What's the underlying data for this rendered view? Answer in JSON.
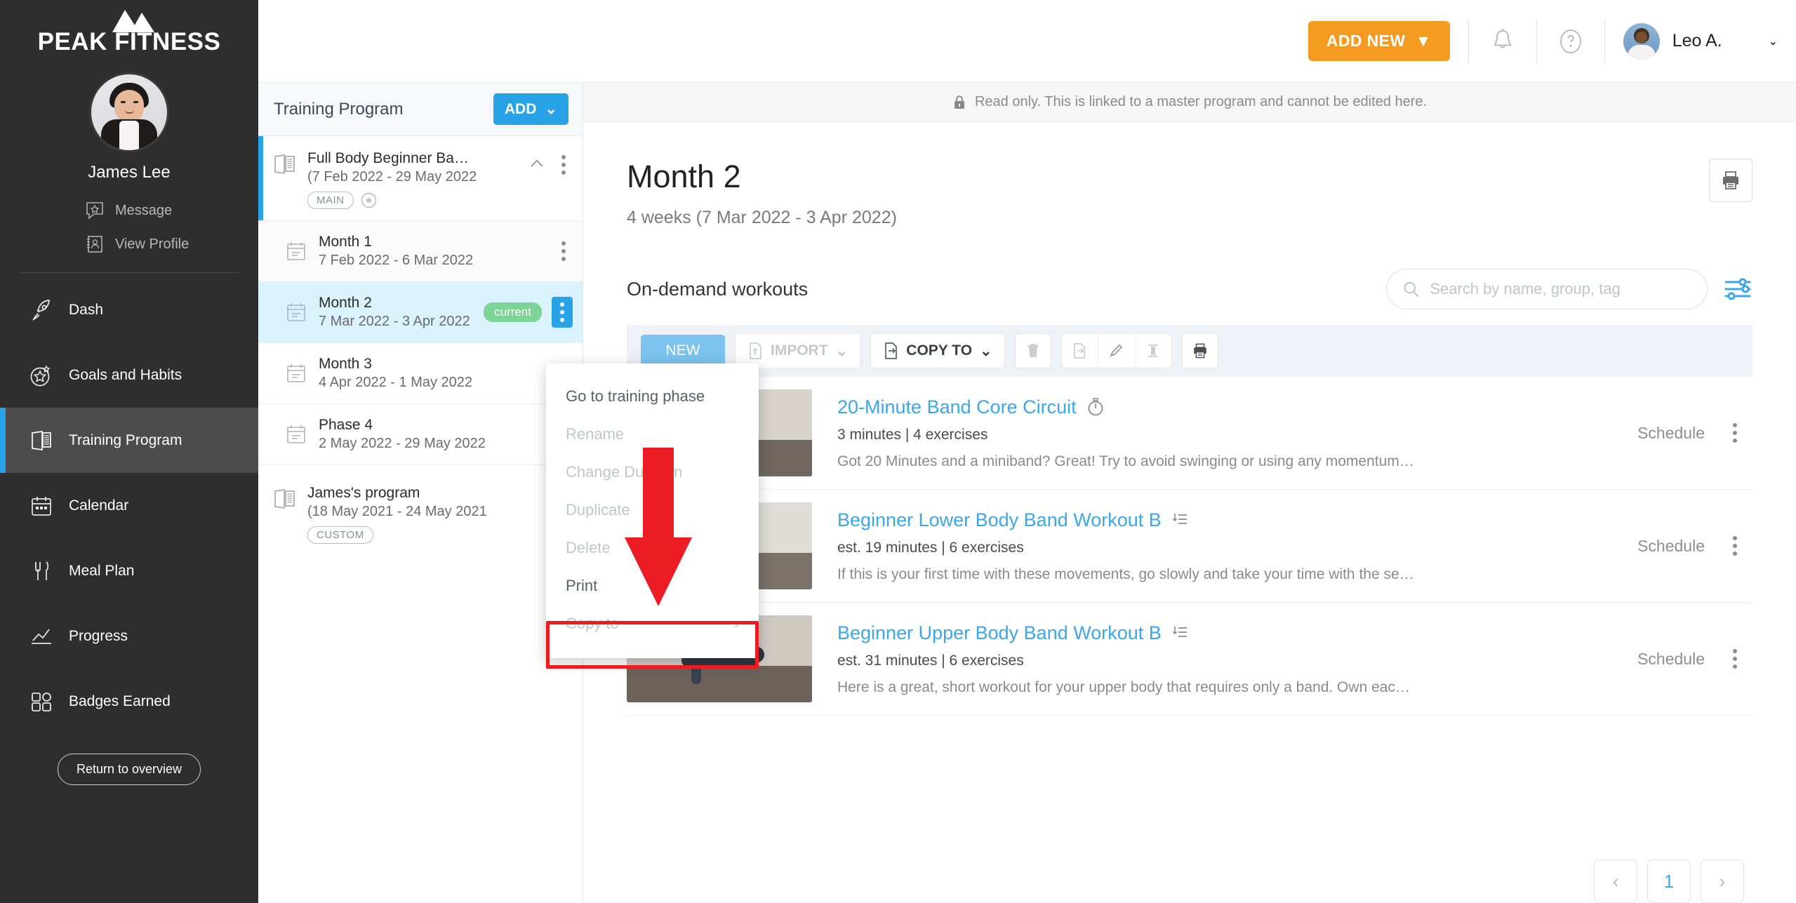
{
  "brand": {
    "name": "PEAK FITNESS",
    "logo_icon": "mountain-peaks-icon"
  },
  "profile": {
    "name": "James Lee",
    "links": [
      {
        "label": "Message",
        "icon": "message-star-icon"
      },
      {
        "label": "View Profile",
        "icon": "contact-book-icon"
      }
    ]
  },
  "sidebar": {
    "items": [
      {
        "label": "Dash",
        "icon": "rocket-icon",
        "active": false
      },
      {
        "label": "Goals and Habits",
        "icon": "star-burst-icon",
        "active": false
      },
      {
        "label": "Training Program",
        "icon": "program-book-icon",
        "active": true
      },
      {
        "label": "Calendar",
        "icon": "calendar-icon",
        "active": false
      },
      {
        "label": "Meal Plan",
        "icon": "fork-knife-icon",
        "active": false
      },
      {
        "label": "Progress",
        "icon": "chart-line-icon",
        "active": false
      },
      {
        "label": "Badges Earned",
        "icon": "badges-grid-icon",
        "active": false
      }
    ],
    "return_button": "Return to overview"
  },
  "topbar": {
    "add_new_label": "ADD NEW",
    "add_new_caret": "▼",
    "add_new_color": "#f59b22",
    "bell_icon": "bell-icon",
    "help_icon": "question-circle-icon",
    "user_name": "Leo A.",
    "user_caret": "⌄"
  },
  "program_panel": {
    "title": "Training Program",
    "add_label": "ADD",
    "add_caret": "⌄",
    "programs": [
      {
        "name": "Full Body Beginner Ba…",
        "dates": "(7 Feb 2022 - 29 May 2022",
        "tag": "MAIN",
        "link_icon": "link-icon",
        "collapse_icon": "chevron-up-icon",
        "selected": true,
        "phases": [
          {
            "name": "Month 1",
            "dates": "7 Feb 2022 - 6 Mar 2022",
            "badge": "",
            "active": false
          },
          {
            "name": "Month 2",
            "dates": "7 Mar 2022 - 3 Apr 2022",
            "badge": "current",
            "active": true
          },
          {
            "name": "Month 3",
            "dates": "4 Apr 2022 - 1 May 2022",
            "badge": "",
            "active": false
          },
          {
            "name": "Phase 4",
            "dates": "2 May 2022 - 29 May 2022",
            "badge": "",
            "active": false
          }
        ]
      },
      {
        "name": "James's program",
        "dates": "(18 May 2021 - 24 May 2021",
        "tag": "CUSTOM",
        "link_icon": "",
        "collapse_icon": "chevron-down-icon",
        "selected": false,
        "phases": []
      }
    ],
    "badge_current_color": "#7ed396"
  },
  "context_menu": {
    "items": [
      {
        "label": "Go to training phase",
        "disabled": false,
        "submenu": false,
        "highlighted": false
      },
      {
        "label": "Rename",
        "disabled": true,
        "submenu": false,
        "highlighted": false
      },
      {
        "label": "Change Duration",
        "disabled": true,
        "submenu": false,
        "highlighted": false
      },
      {
        "label": "Duplicate",
        "disabled": true,
        "submenu": false,
        "highlighted": false
      },
      {
        "label": "Delete",
        "disabled": true,
        "submenu": false,
        "highlighted": false
      },
      {
        "label": "Print",
        "disabled": false,
        "submenu": false,
        "highlighted": true
      },
      {
        "label": "Copy to",
        "disabled": true,
        "submenu": true,
        "highlighted": false
      }
    ],
    "submenu_arrow": "›",
    "highlight_color": "#ec1c24",
    "annotation_arrow_color": "#ec1c24"
  },
  "content": {
    "readonly_notice": "Read only. This is linked to a master program and cannot be edited here.",
    "lock_icon": "lock-icon",
    "title": "Month 2",
    "subtitle": "4 weeks (7 Mar 2022 - 3 Apr 2022)",
    "print_icon": "printer-icon",
    "section_title": "On-demand workouts",
    "search_placeholder": "Search by name, group, tag",
    "search_value": "",
    "search_icon": "search-icon",
    "filter_icon": "sliders-filter-icon",
    "toolbar": {
      "new_label": "NEW",
      "import_label": "IMPORT",
      "import_caret": "⌄",
      "copy_to_label": "COPY TO",
      "copy_to_caret": "⌄",
      "delete_icon": "trash-icon",
      "move_icon": "file-move-icon",
      "edit_icon": "pencil-icon",
      "column_icon": "column-icon",
      "print_icon": "printer-icon"
    },
    "workouts": [
      {
        "title": "20-Minute Band Core Circuit",
        "type_icon": "stopwatch-icon",
        "meta": "3 minutes | 4 exercises",
        "description": "Got 20 Minutes and a miniband? Great! Try to avoid swinging or using any momentum…",
        "schedule_label": "Schedule"
      },
      {
        "title": "Beginner Lower Body Band Workout B",
        "type_icon": "ordered-list-icon",
        "meta": "est. 19 minutes | 6 exercises",
        "description": "If this is your first time with these movements, go slowly and take your time with the se…",
        "schedule_label": "Schedule"
      },
      {
        "title": "Beginner Upper Body Band Workout B",
        "type_icon": "ordered-list-icon",
        "meta": "est. 31 minutes | 6 exercises",
        "description": "Here is a great, short workout for your upper body that requires only a band. Own eac…",
        "schedule_label": "Schedule"
      }
    ],
    "pagination": {
      "prev": "‹",
      "current_page": "1",
      "next": "›"
    }
  },
  "colors": {
    "accent_blue": "#29a3e8",
    "orange": "#f59b22",
    "green": "#7ed396",
    "sidebar_bg": "#2e2e2e"
  }
}
